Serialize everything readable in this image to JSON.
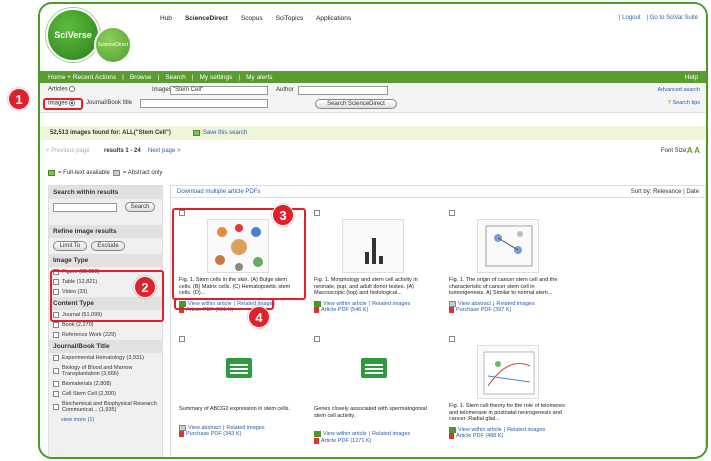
{
  "header": {
    "logo": "SciVerse",
    "logo_sub": "ScienceDirect",
    "nav": [
      "Hub",
      "ScienceDirect",
      "Scopus",
      "SciTopics",
      "Applications"
    ],
    "links": [
      "| Logout",
      "| Go to SciVal Suite"
    ]
  },
  "greenbar": {
    "items": [
      "Home + Recent Actions",
      "|",
      "Browse",
      "|",
      "Search",
      "|",
      "My settings",
      "|",
      "My alerts"
    ],
    "help": "Help"
  },
  "search": {
    "articles_label": "Articles",
    "images_label": "Images",
    "images_field_label": "Images",
    "images_value": "\"Stem Cell\"",
    "author_label": "Author",
    "journal_label": "Journal/Book title",
    "button": "Search ScienceDirect",
    "advanced": "Advanced search",
    "tips": "Search tips"
  },
  "results": {
    "count": "52,513 images found for: ALL(\"Stem Cell\")",
    "save": "Save this search",
    "prev": "< Previous page",
    "range": "results 1 - 24",
    "next": "Next page >",
    "font_size": "Font Size:"
  },
  "legend": {
    "full": "= Full-text available",
    "abstract": "= Abstract only"
  },
  "sidebar": {
    "search_within": "Search within results",
    "search_btn": "Search",
    "refine": "Refine image results",
    "limit": "Limit To",
    "exclude": "Exclude",
    "image_type": "Image Type",
    "image_types": [
      "Figure (39,858)",
      "Table (12,821)",
      "Video (33)"
    ],
    "content_type": "Content Type",
    "content_types": [
      "Journal (51,099)",
      "Book (2,270)",
      "Reference Work (229)"
    ],
    "journal_title": "Journal/Book Title",
    "journals": [
      "Experimental Hematology (3,931)",
      "Biology of Blood and Marrow Transplantation (3,666)",
      "Biomaterials (2,808)",
      "Cell Stem Cell (2,300)",
      "Biochemical and Biophysical Research Communicat... (1,935)",
      "view more (1)"
    ]
  },
  "main": {
    "download": "Download multiple article PDFs",
    "sort": "Sort by: Relevance | Date",
    "cards": [
      {
        "caption": "Fig. 1. Stem cells in the skin. (A) Bulge stem cells. (B) Matrix cells. (C) Hematopoietic stem cells. (D)...",
        "link1": "View within article",
        "link2": "Related images",
        "pdf": "Article PDF (551 K)"
      },
      {
        "caption": "Fig. 1. Morphology and stem cell activity in neonate, pup, and adult donor testes. (A) Macroscopic (top) and histological...",
        "link1": "View within article",
        "link2": "Related images",
        "pdf": "Article PDF (546 K)"
      },
      {
        "caption": "Fig. 1. The origin of cancer stem cell and the characteristic of cancer stem cell in tumorigenesis. A) Similar to normal stem...",
        "link1": "View abstract",
        "link2": "Related images",
        "pdf": "Purchase PDF (397 K)"
      },
      {
        "caption": "Summary of ABCG2 expression in stem cells.",
        "link1": "View abstract",
        "link2": "Related images",
        "pdf": "Purchase PDF (343 K)"
      },
      {
        "caption": "Genes closely associated with spermatogonial stem cell activity.",
        "link1": "View within article",
        "link2": "Related images",
        "pdf": "Article PDF (1271 K)"
      },
      {
        "caption": "Fig. 1. Stem cell theory for the role of telomeres and telomerase in postnatal neurogenesis and cancer. Radial glial...",
        "link1": "View within article",
        "link2": "Related images",
        "pdf": "Article PDF (488 K)"
      }
    ]
  },
  "badges": [
    "1",
    "2",
    "3",
    "4"
  ],
  "colors": {
    "brand_green": "#5a9c2f",
    "annotation_red": "#e0202a",
    "link_blue": "#2a5db0"
  }
}
